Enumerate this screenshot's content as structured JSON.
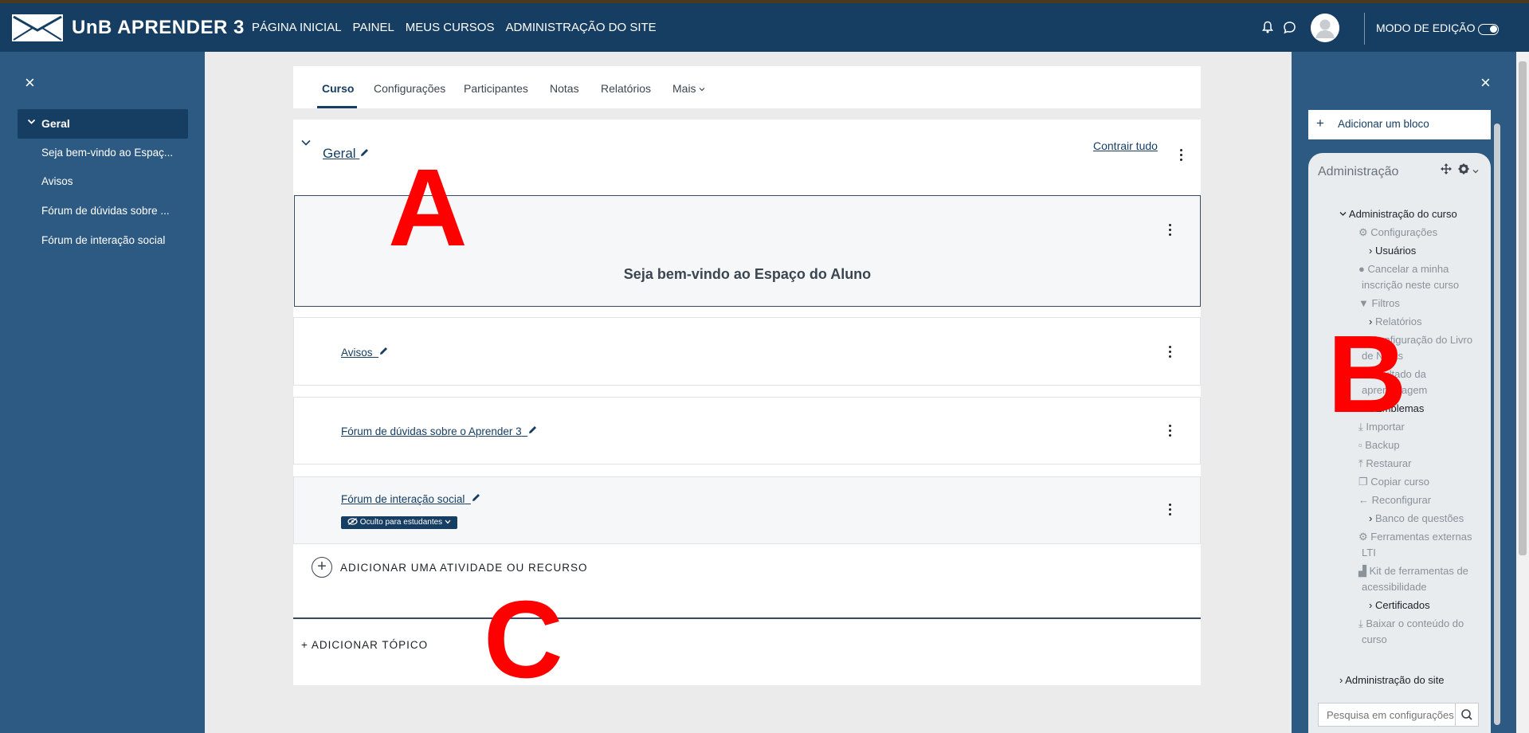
{
  "header": {
    "brand": "UnB APRENDER 3",
    "nav": [
      "PÁGINA INICIAL",
      "PAINEL",
      "MEUS CURSOS",
      "ADMINISTRAÇÃO DO SITE"
    ],
    "edit_mode_label": "MODO DE EDIÇÃO",
    "edit_mode_on": true
  },
  "course_index": {
    "close_glyph": "×",
    "section": "Geral",
    "items": [
      "Seja bem-vindo ao Espaç...",
      "Avisos",
      "Fórum de dúvidas sobre ...",
      "Fórum de interação social"
    ]
  },
  "tabs": [
    "Curso",
    "Configurações",
    "Participantes",
    "Notas",
    "Relatórios",
    "Mais"
  ],
  "section": {
    "title": "Geral",
    "collapse_all": "Contrair tudo"
  },
  "label": {
    "text": "Seja bem-vindo ao Espaço do Aluno"
  },
  "activities": [
    {
      "name": "Avisos"
    },
    {
      "name": "Fórum de dúvidas sobre o Aprender 3"
    },
    {
      "name": "Fórum de interação social",
      "badge": "Oculto para estudantes"
    }
  ],
  "add_activity": "ADICIONAR UMA ATIVIDADE OU RECURSO",
  "add_topic": "ADICIONAR TÓPICO",
  "block_drawer": {
    "close_glyph": "×",
    "add_block": "Adicionar um bloco",
    "admin_title": "Administração",
    "tree": {
      "course_admin": "Administração do curso",
      "configuracoes": "Configurações",
      "usuarios": "Usuários",
      "cancelar_l1": "Cancelar a minha",
      "cancelar_l2": "inscrição neste curso",
      "filtros": "Filtros",
      "relatorios": "Relatórios",
      "livro_l1": "Configuração do Livro",
      "livro_l2": "de Notas",
      "resultado_l1": "Resultado da",
      "resultado_l2": "aprendizagem",
      "emblemas": "Emblemas",
      "importar": "Importar",
      "backup": "Backup",
      "restaurar": "Restaurar",
      "copiar": "Copiar curso",
      "reconfigurar": "Reconfigurar",
      "banco": "Banco de questões",
      "lti_l1": "Ferramentas externas",
      "lti_l2": "LTI",
      "kit_l1": "Kit de ferramentas de",
      "kit_l2": "acessibilidade",
      "certificados": "Certificados",
      "baixar_l1": "Baixar o conteúdo do",
      "baixar_l2": "curso",
      "site_admin": "Administração do site"
    },
    "search_placeholder": "Pesquisa em configurações"
  },
  "annotations": {
    "a": "A",
    "b": "B",
    "c": "C"
  },
  "colors": {
    "navbar": "#163e62",
    "drawer": "#2d5a82",
    "annotation": "#ff0000"
  }
}
